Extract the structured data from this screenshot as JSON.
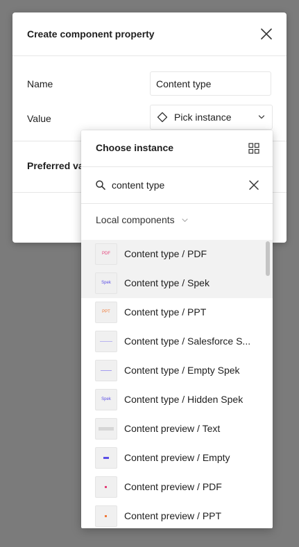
{
  "dialog": {
    "title": "Create component property",
    "name_label": "Name",
    "name_value": "Content type",
    "value_label": "Value",
    "value_select": "Pick instance",
    "preferred_label": "Preferred values"
  },
  "dropdown": {
    "title": "Choose instance",
    "search_value": "content type",
    "section_label": "Local components",
    "items": [
      {
        "label": "Content type / PDF",
        "thumb": "PDF"
      },
      {
        "label": "Content type / Spek",
        "thumb": "Spek"
      },
      {
        "label": "Content type / PPT",
        "thumb": "PPT"
      },
      {
        "label": "Content type / Salesforce S..."
      },
      {
        "label": "Content type / Empty Spek"
      },
      {
        "label": "Content type / Hidden Spek",
        "thumb": "Spek"
      },
      {
        "label": "Content preview / Text"
      },
      {
        "label": "Content preview / Empty"
      },
      {
        "label": "Content preview / PDF"
      },
      {
        "label": "Content preview / PPT"
      }
    ]
  },
  "colors": {
    "backdrop": "#7b7b7b",
    "pdf": "#e5407a",
    "spek": "#5b4ee6",
    "ppt": "#f07a3a"
  },
  "icons": [
    "close-icon",
    "diamond-icon",
    "chevron-down-icon",
    "grid-icon",
    "search-icon",
    "clear-icon"
  ]
}
